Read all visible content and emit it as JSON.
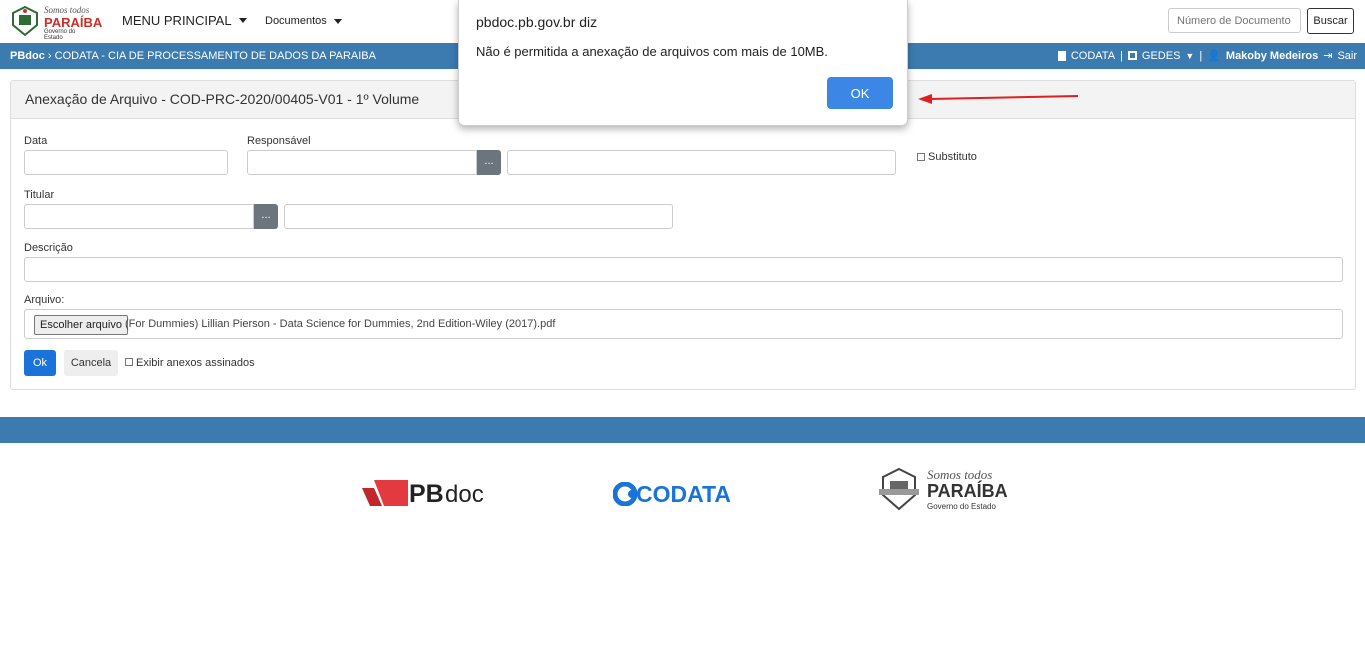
{
  "header": {
    "logo_top": "Somos todos",
    "logo_main": "PARAÍBA",
    "logo_sub": "Governo do Estado",
    "menu_principal": "MENU PRINCIPAL",
    "documentos": "Documentos",
    "search_placeholder": "Número de Documento",
    "search_button": "Buscar"
  },
  "breadcrumb": {
    "app": "PBdoc",
    "org": "CODATA - CIA DE PROCESSAMENTO DE DADOS DA PARAIBA",
    "unit": "CODATA",
    "sep": "|",
    "dept": "GEDES",
    "user": "Makoby Medeiros",
    "logout": "Sair"
  },
  "form": {
    "title": "Anexação de Arquivo - COD-PRC-2020/00405-V01 - 1º Volume",
    "data_label": "Data",
    "responsavel_label": "Responsável",
    "dots": "...",
    "substituto_label": "Substituto",
    "titular_label": "Titular",
    "descricao_label": "Descrição",
    "arquivo_label": "Arquivo:",
    "file_button": "Escolher arquivo",
    "file_name": "(For Dummies) Lillian Pierson - Data Science for Dummies, 2nd Edition-Wiley (2017).pdf",
    "ok_label": "Ok",
    "cancel_label": "Cancela",
    "exibir_label": "Exibir anexos assinados"
  },
  "dialog": {
    "title": "pbdoc.pb.gov.br diz",
    "message": "Não é permitida a anexação de arquivos com mais de 10MB.",
    "ok": "OK"
  },
  "footer": {
    "pbdoc_pb": "PB",
    "pbdoc_doc": "doc",
    "codata": "CODATA",
    "pb_top": "Somos todos",
    "pb_main": "PARAÍBA",
    "pb_sub": "Governo do Estado"
  },
  "colors": {
    "bar": "#3c7bb0",
    "primary": "#1a73d9",
    "dialog_ok": "#3c87e6",
    "arrow": "#e02020"
  }
}
